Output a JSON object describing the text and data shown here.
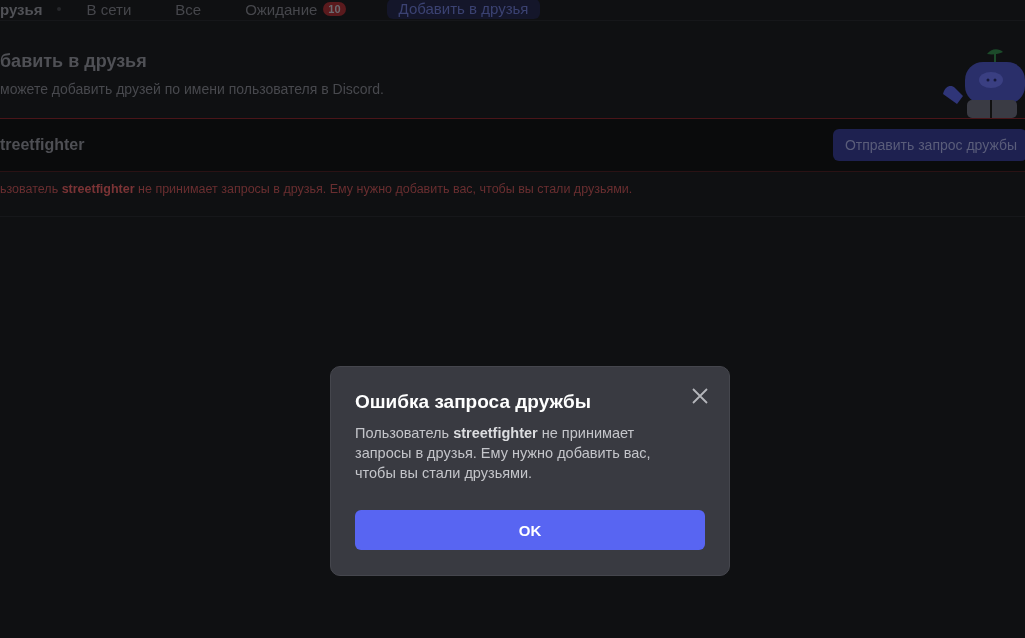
{
  "header": {
    "title": "рузья",
    "tabs": [
      {
        "label": "В сети"
      },
      {
        "label": "Все"
      },
      {
        "label": "Ожидание",
        "badge": "10"
      }
    ],
    "add_button": "Добавить в друзья"
  },
  "add_friend": {
    "heading": "бавить в друзья",
    "subtitle": "можете добавить друзей по имени пользователя в Discord.",
    "input_value": "treetfighter",
    "send_button": "Отправить запрос дружбы",
    "error": "ьзователь **streetfighter** не принимает запросы в друзья. Ему нужно добавить вас, чтобы вы стали друзьями."
  },
  "dialog": {
    "title": "Ошибка запроса дружбы",
    "message": "Пользователь **streetfighter** не принимает запросы в друзья. Ему нужно добавить вас, чтобы вы стали друзьями.",
    "ok_button": "OK"
  }
}
